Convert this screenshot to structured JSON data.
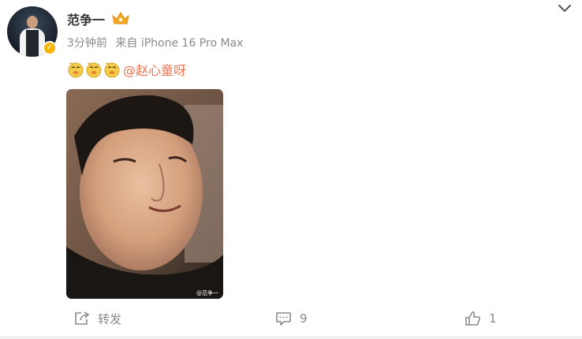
{
  "post": {
    "author": "范争一",
    "time": "3分钟前",
    "source": "来自 iPhone 16 Pro Max",
    "mention": "@赵心童呀",
    "watermark": "@范争一"
  },
  "actions": {
    "repost_label": "转发",
    "comment_count": "9",
    "like_count": "1"
  },
  "icons": {
    "emoji": "doge-emoji-icon",
    "crown": "crown-badge-icon",
    "verified": "verified-icon",
    "menu": "chevron-down-icon"
  },
  "colors": {
    "mention": "#eb7350",
    "verified": "#f7b500",
    "meta": "#8a8a8a"
  }
}
